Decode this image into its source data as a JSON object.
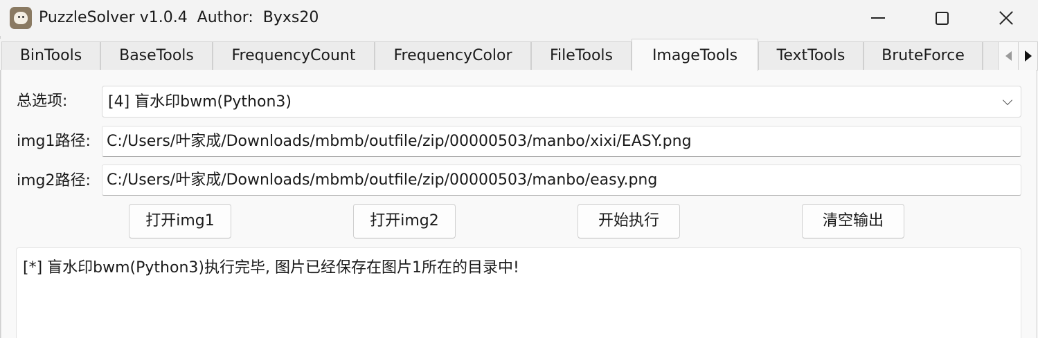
{
  "window": {
    "title": "PuzzleSolver v1.0.4  Author:  Byxs20",
    "icon": "sheep-icon",
    "controls": [
      "minimize",
      "maximize",
      "close"
    ]
  },
  "tabs": [
    {
      "label": "BinTools",
      "active": false
    },
    {
      "label": "BaseTools",
      "active": false
    },
    {
      "label": "FrequencyCount",
      "active": false
    },
    {
      "label": "FrequencyColor",
      "active": false
    },
    {
      "label": "FileTools",
      "active": false
    },
    {
      "label": "ImageTools",
      "active": true
    },
    {
      "label": "TextTools",
      "active": false
    },
    {
      "label": "BruteForce",
      "active": false
    }
  ],
  "form": {
    "option_label": "总选项:",
    "option_value": "[4] 盲水印bwm(Python3)",
    "img1_label": "img1路径:",
    "img1_value": "C:/Users/叶家成/Downloads/mbmb/outfile/zip/00000503/manbo/xixi/EASY.png",
    "img2_label": "img2路径:",
    "img2_value": "C:/Users/叶家成/Downloads/mbmb/outfile/zip/00000503/manbo/easy.png"
  },
  "buttons": {
    "open_img1": "打开img1",
    "open_img2": "打开img2",
    "execute": "开始执行",
    "clear_output": "清空输出"
  },
  "output": {
    "text": "[*] 盲水印bwm(Python3)执行完毕, 图片已经保存在图片1所在的目录中!"
  }
}
